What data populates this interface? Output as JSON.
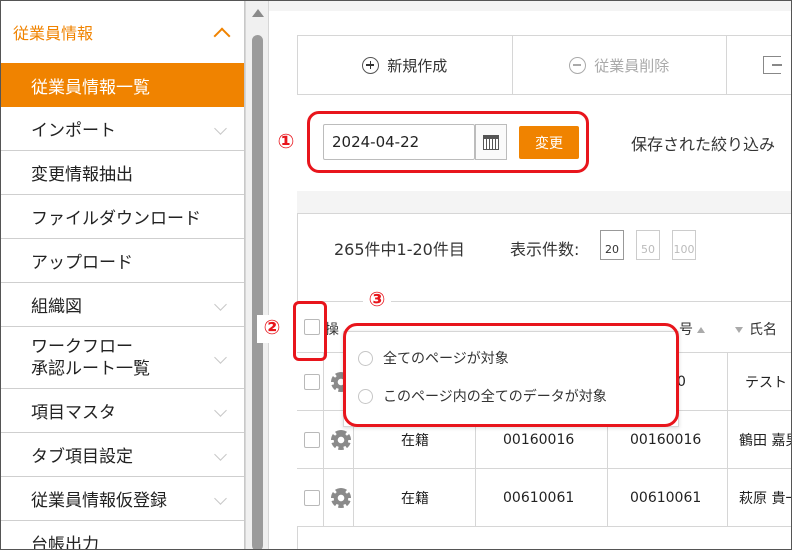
{
  "sidebar": {
    "header_title": "従業員情報",
    "items": [
      {
        "label": "従業員情報一覧"
      },
      {
        "label": "インポート"
      },
      {
        "label": "変更情報抽出"
      },
      {
        "label": "ファイルダウンロード"
      },
      {
        "label": "アップロード"
      },
      {
        "label": "組織図"
      },
      {
        "label": "ワークフロー\n承認ルート一覧"
      },
      {
        "label": "項目マスタ"
      },
      {
        "label": "タブ項目設定"
      },
      {
        "label": "従業員情報仮登録"
      },
      {
        "label": "台帳出力"
      }
    ]
  },
  "toolbar": {
    "new_label": "新規作成",
    "delete_label": "従業員削除"
  },
  "date_filter": {
    "value": "2024-04-22",
    "change_label": "変更",
    "saved_filter_label": "保存された絞り込み"
  },
  "list": {
    "count_text": "265件中1-20件目",
    "page_size_label": "表示件数:",
    "page_size_options": [
      "20",
      "50",
      "100"
    ],
    "header": {
      "ops": "操",
      "num_partial": "号",
      "name": "氏名"
    },
    "rows": [
      {
        "status": "",
        "emp_no": "",
        "code": "0",
        "name": "テスト"
      },
      {
        "status": "在籍",
        "emp_no": "00160016",
        "code": "00160016",
        "name": "鶴田 嘉男"
      },
      {
        "status": "在籍",
        "emp_no": "00610061",
        "code": "00610061",
        "name": "萩原 貴一"
      }
    ]
  },
  "popup": {
    "option_all_pages": "全てのページが対象",
    "option_this_page": "このページ内の全てのデータが対象"
  },
  "annotations": [
    "①",
    "②",
    "③"
  ],
  "colors": {
    "accent": "#f08300",
    "annotation_red": "#e8151c"
  }
}
